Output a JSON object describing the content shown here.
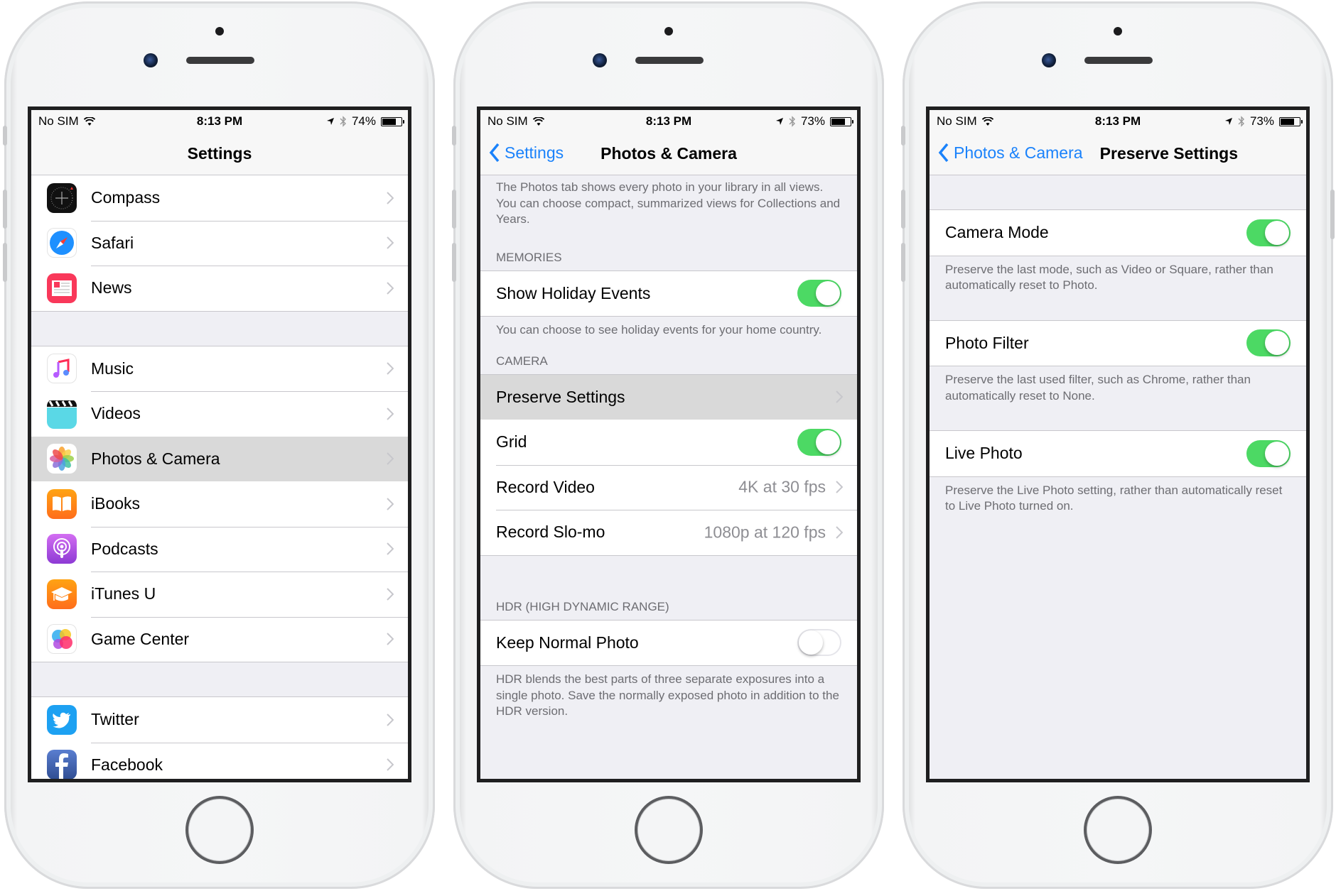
{
  "phones": [
    {
      "status": {
        "carrier": "No SIM",
        "time": "8:13 PM",
        "battery": "74%",
        "battery_level": 0.74
      },
      "nav": {
        "title": "Settings"
      },
      "groups": [
        [
          {
            "label": "Compass",
            "icon": "compass-icon"
          },
          {
            "label": "Safari",
            "icon": "safari-icon"
          },
          {
            "label": "News",
            "icon": "news-icon"
          }
        ],
        [
          {
            "label": "Music",
            "icon": "music-icon"
          },
          {
            "label": "Videos",
            "icon": "videos-icon"
          },
          {
            "label": "Photos & Camera",
            "icon": "photos-icon",
            "selected": true
          },
          {
            "label": "iBooks",
            "icon": "ibooks-icon"
          },
          {
            "label": "Podcasts",
            "icon": "podcasts-icon"
          },
          {
            "label": "iTunes U",
            "icon": "itunes-u-icon"
          },
          {
            "label": "Game Center",
            "icon": "game-center-icon"
          }
        ],
        [
          {
            "label": "Twitter",
            "icon": "twitter-icon"
          },
          {
            "label": "Facebook",
            "icon": "facebook-icon"
          }
        ]
      ]
    },
    {
      "status": {
        "carrier": "No SIM",
        "time": "8:13 PM",
        "battery": "73%",
        "battery_level": 0.73
      },
      "nav": {
        "title": "Photos & Camera",
        "back": "Settings"
      },
      "intro_footer": "The Photos tab shows every photo in your library in all views. You can choose compact, summarized views for Collections and Years.",
      "memories": {
        "header": "MEMORIES",
        "show_holiday_events": {
          "label": "Show Holiday Events",
          "on": true
        },
        "footer": "You can choose to see holiday events for your home country."
      },
      "camera": {
        "header": "CAMERA",
        "preserve_settings": {
          "label": "Preserve Settings"
        },
        "grid": {
          "label": "Grid",
          "on": true
        },
        "record_video": {
          "label": "Record Video",
          "value": "4K at 30 fps"
        },
        "record_slomo": {
          "label": "Record Slo-mo",
          "value": "1080p at 120 fps"
        }
      },
      "hdr": {
        "header": "HDR (HIGH DYNAMIC RANGE)",
        "keep_normal_photo": {
          "label": "Keep Normal Photo",
          "on": false
        },
        "footer": "HDR blends the best parts of three separate exposures into a single photo. Save the normally exposed photo in addition to the HDR version."
      }
    },
    {
      "status": {
        "carrier": "No SIM",
        "time": "8:13 PM",
        "battery": "73%",
        "battery_level": 0.73
      },
      "nav": {
        "title": "Preserve Settings",
        "back": "Photos & Camera"
      },
      "items": [
        {
          "label": "Camera Mode",
          "on": true,
          "footer": "Preserve the last mode, such as Video or Square, rather than automatically reset to Photo."
        },
        {
          "label": "Photo Filter",
          "on": true,
          "footer": "Preserve the last used filter, such as Chrome, rather than automatically reset to None."
        },
        {
          "label": "Live Photo",
          "on": true,
          "footer": "Preserve the Live Photo setting, rather than automatically reset to Live Photo turned on."
        }
      ]
    }
  ],
  "colors": {
    "tint": "#1a82fb",
    "switch_on": "#4cd964",
    "group_bg": "#efeff4",
    "secondary_text": "#6d6d72",
    "value_text": "#8e8e93"
  }
}
